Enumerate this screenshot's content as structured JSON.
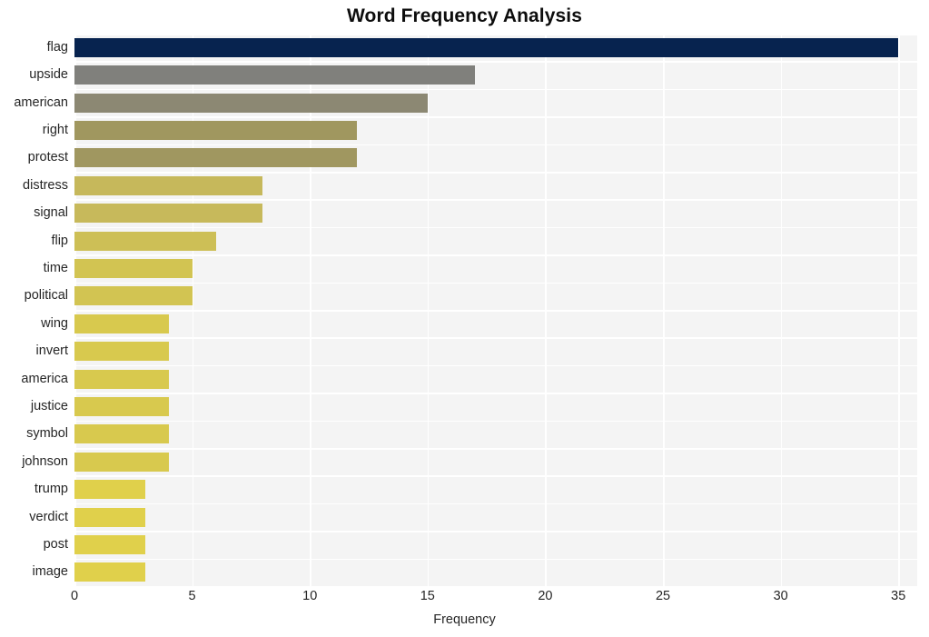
{
  "chart_data": {
    "type": "bar",
    "orientation": "horizontal",
    "title": "Word Frequency Analysis",
    "xlabel": "Frequency",
    "ylabel": "",
    "categories": [
      "flag",
      "upside",
      "american",
      "right",
      "protest",
      "distress",
      "signal",
      "flip",
      "time",
      "political",
      "wing",
      "invert",
      "america",
      "justice",
      "symbol",
      "johnson",
      "trump",
      "verdict",
      "post",
      "image"
    ],
    "values": [
      35,
      17,
      15,
      12,
      12,
      8,
      8,
      6,
      5,
      5,
      4,
      4,
      4,
      4,
      4,
      4,
      3,
      3,
      3,
      3
    ],
    "xlim": [
      0,
      35.8
    ],
    "xticks": [
      0,
      5,
      10,
      15,
      20,
      25,
      30,
      35
    ],
    "xtick_labels": [
      "0",
      "5",
      "10",
      "15",
      "20",
      "25",
      "30",
      "35"
    ],
    "grid": true,
    "legend": false,
    "bar_colors": [
      "#07234f",
      "#80807c",
      "#8c8873",
      "#a0975f",
      "#a09760",
      "#c6b85b",
      "#c7b95b",
      "#cdbf56",
      "#d2c452",
      "#d2c452",
      "#d8c94e",
      "#d8c94e",
      "#d8c94e",
      "#d8c94e",
      "#d8c94e",
      "#d8c94e",
      "#e0d04b",
      "#e0d04b",
      "#e0d04b",
      "#e0d04b"
    ],
    "plot_background": "#f4f4f4",
    "grid_color": "#ffffff",
    "title_color": "#0d0d0d",
    "tick_color": "#262626"
  }
}
